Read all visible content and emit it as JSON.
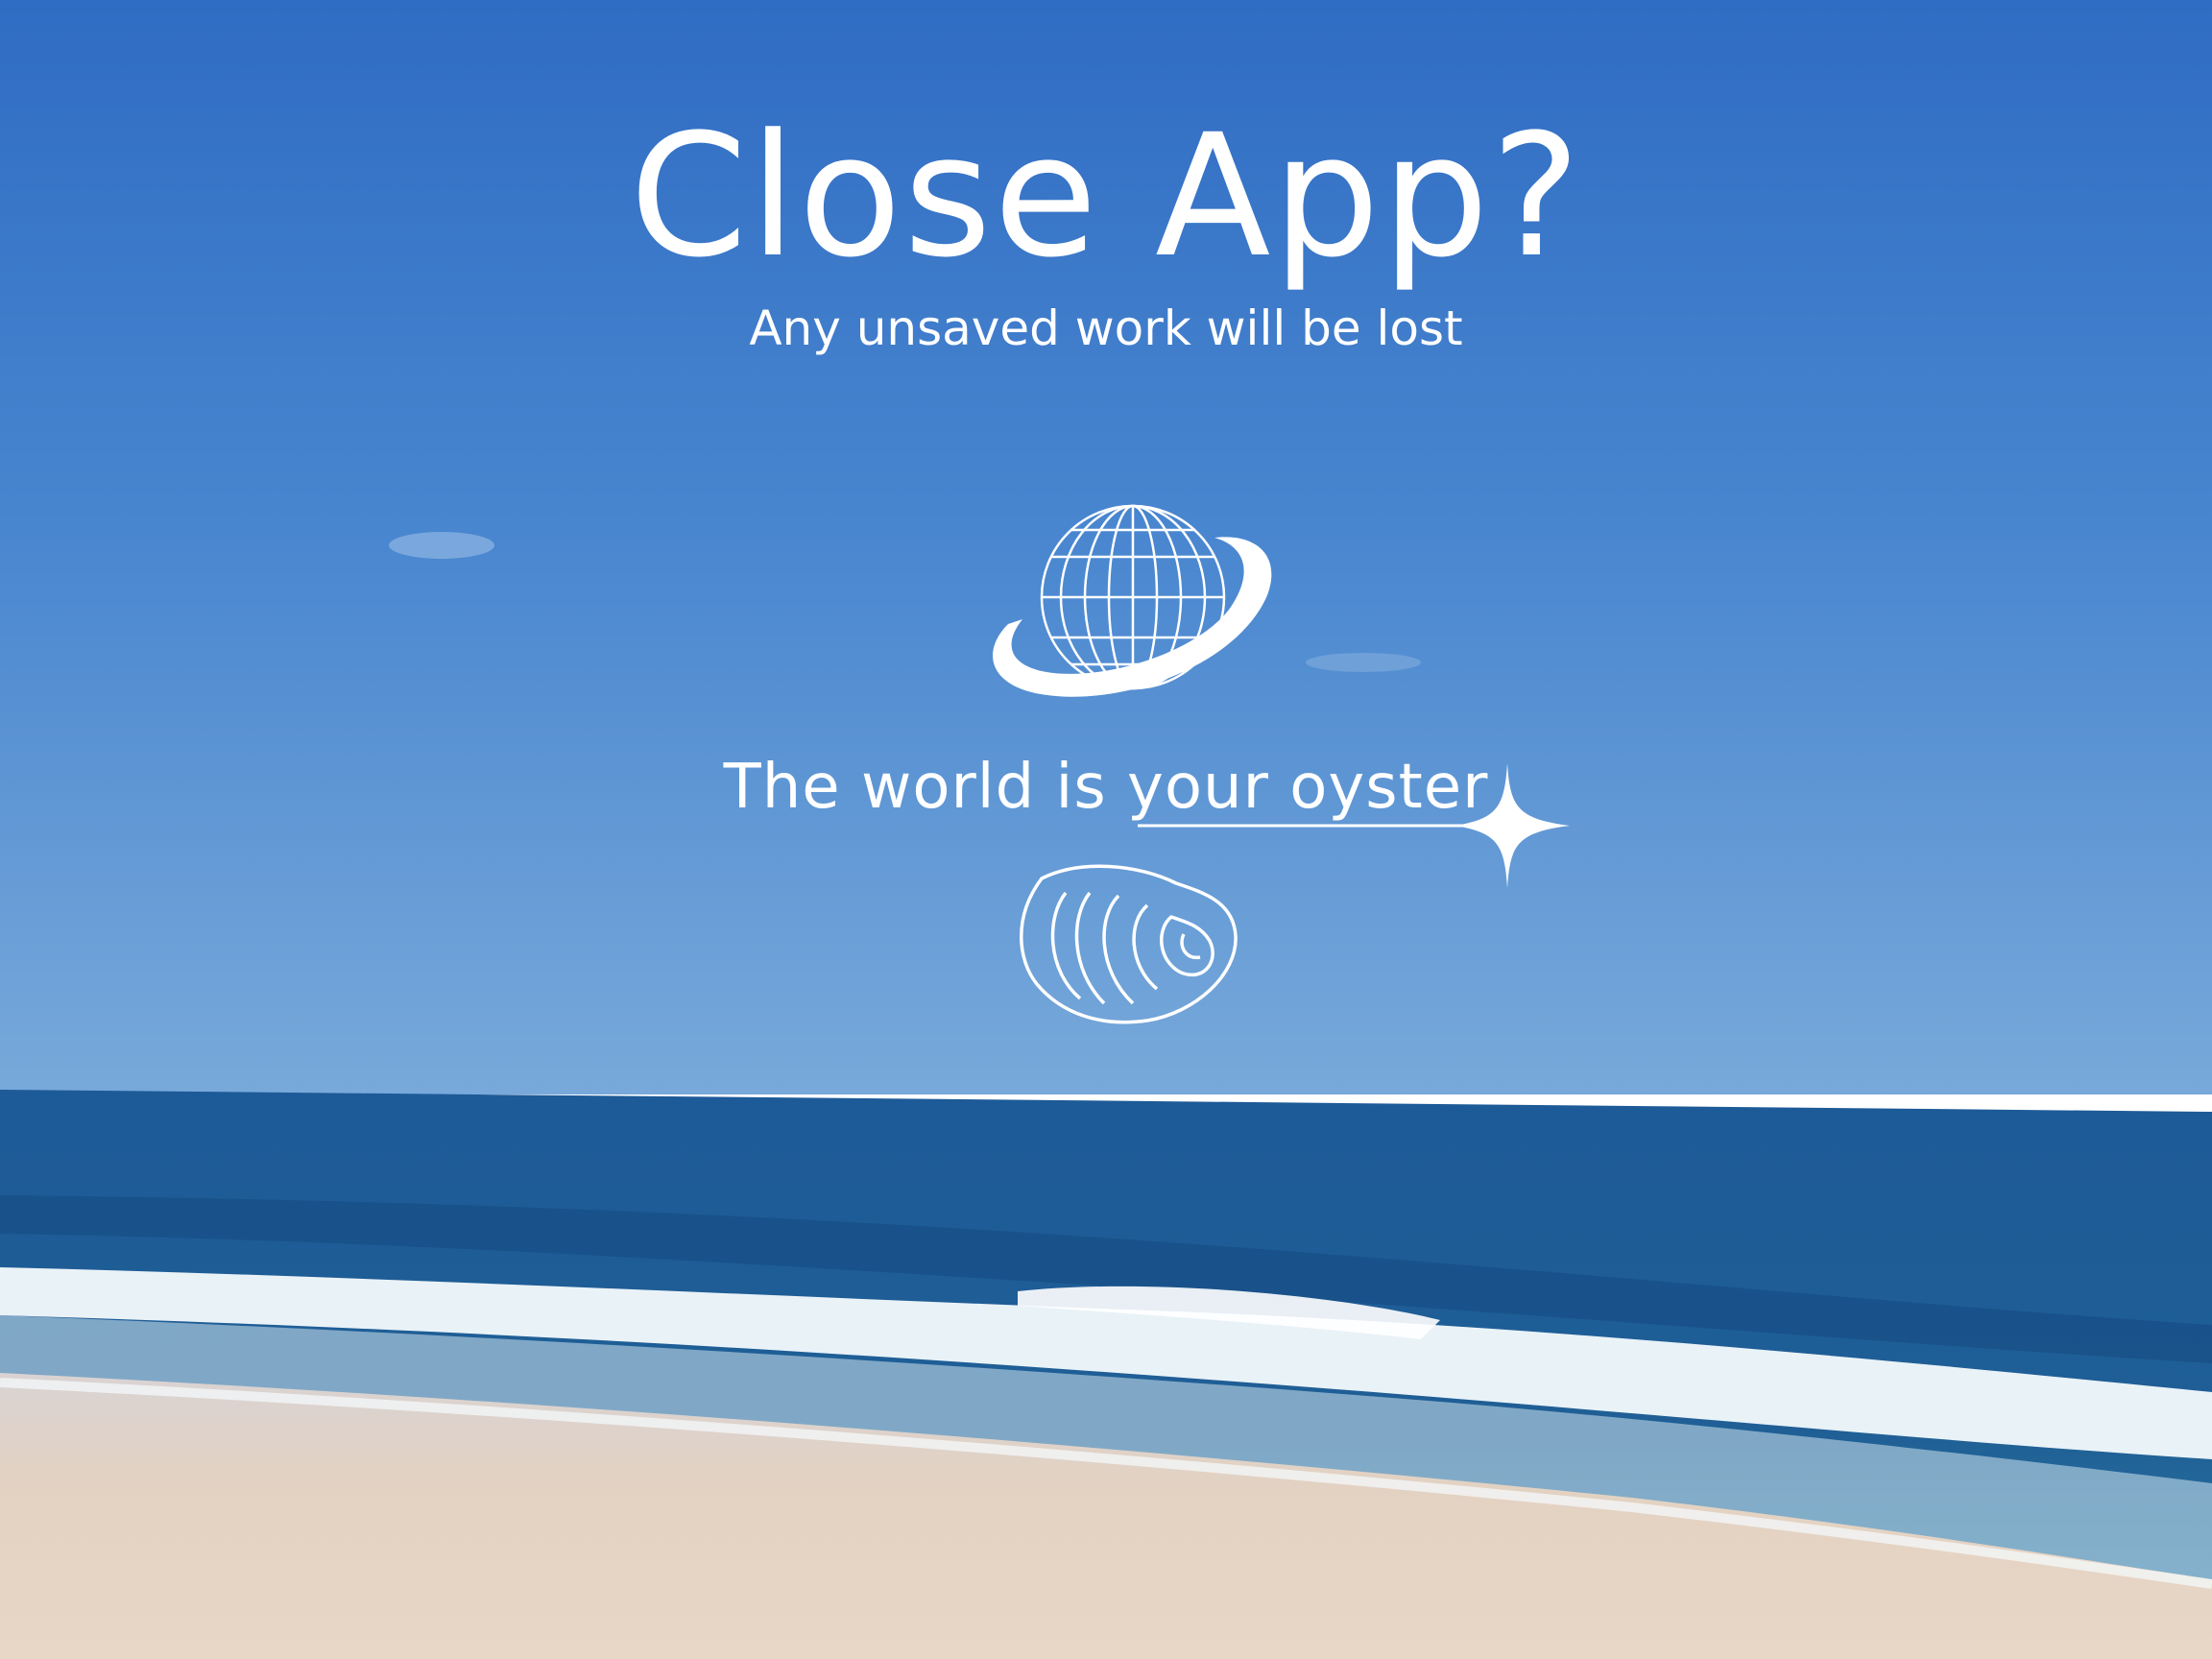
{
  "dialog": {
    "title": "Close App?",
    "subtitle": "Any unsaved work will be lost",
    "tagline": "The world is your oyster"
  },
  "icons": {
    "globe": "globe-with-ring-icon",
    "sparkle": "sparkle-underline-icon",
    "oyster": "oyster-shell-icon"
  },
  "colors": {
    "sky_top": "#3a78c9",
    "sky_bottom": "#6aa0d6",
    "sea": "#1f5c97",
    "surf": "#e6f0f6",
    "sand": "#e4d6c8",
    "text": "#ffffff"
  }
}
